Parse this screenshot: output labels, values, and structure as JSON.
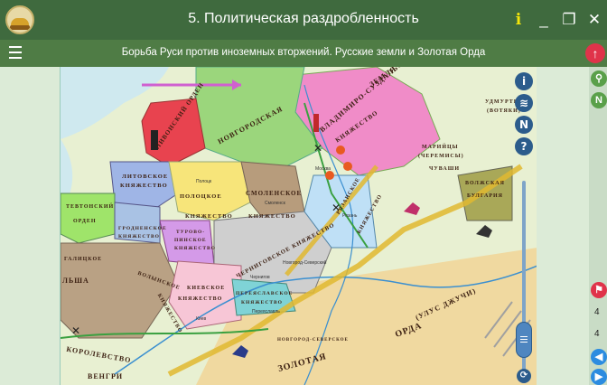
{
  "window": {
    "title": "5. Политическая раздробленность",
    "info_label": "i",
    "minimize_label": "_",
    "maximize_label": "❐",
    "close_label": "✕"
  },
  "subheader": {
    "title": "Борьба Руси против иноземных вторжений. Русские земли и Золотая Орда",
    "up_label": "↑"
  },
  "map_tools": {
    "info_label": "i",
    "layers_label": "≋",
    "north_label": "N",
    "help_label": "?"
  },
  "right_panel": {
    "num1": "4",
    "num2": "4"
  },
  "map": {
    "labels": {
      "vladimir": "ВЛАДИМИРО-СУЗДАЛЬСКАЯ",
      "zemlya": "ЗЕМЛЯ",
      "knyazhestvo_vs": "КНЯЖЕСТВО",
      "novgorod": "НОВГОРОДСКАЯ",
      "livonsky": "ЛИВОНСКИЙ ОРДЕН",
      "litovskoe": "ЛИТОВСКОЕ",
      "knyazhestvo_lit": "КНЯЖЕСТВО",
      "polotskoe": "ПОЛОЦКОЕ",
      "knyazhestvo_pol": "КНЯЖЕСТВО",
      "smolenskoe": "СМОЛЕНСКОЕ",
      "knyazhestvo_sm": "КНЯЖЕСТВО",
      "tevtonsky": "ТЕВТОНСКИЙ",
      "orden": "ОРДЕН",
      "grodnenskoe": "ГРОДНЕНСКОЕ",
      "knyazhestvo_gr": "КНЯЖЕСТВО",
      "turovo": "ТУРОВО-",
      "pinskoe": "ПИНСКОЕ",
      "knyazhestvo_tp": "КНЯЖЕСТВО",
      "chernigovskoe": "ЧЕРНИГОВСКОЕ КНЯЖЕСТВО",
      "ryazanskoe": "РЯЗАНСКОЕ",
      "knyazhestvo_r": "КНЯЖЕСТВО",
      "volynskoe": "ВОЛЫНСКОЕ",
      "knyazhestvo_v": "КНЯЖЕСТВО",
      "galitskoe": "ГАЛИЦКОЕ",
      "kievskoe": "КИЕВСКОЕ",
      "knyazhestvo_k": "КНЯЖЕСТВО",
      "pereyaslavskoe": "ПЕРЕЯСЛАВСКОЕ",
      "knyazhestvo_p": "КНЯЖЕСТВО",
      "novgorod_severskoe": "НОВГОРОД-СЕВЕРСКОЕ",
      "zolotaya": "ЗОЛОТАЯ",
      "orda": "ОРДА",
      "ulus": "(УЛУС ДЖУЧИ)",
      "udmurty": "УДМУРТЫ",
      "votyaki": "(ВОТЯКИ)",
      "mariytsy": "МАРИЙЦЫ",
      "cheremisy": "(ЧЕРЕМИСЫ)",
      "chuvashi": "ЧУВАШИ",
      "volzhskaya": "ВОЛЖСКАЯ",
      "bulgariya": "БУЛГАРИЯ",
      "korolevstvo": "КОРОЛЕВСТВО",
      "polsha": "ЛЬША",
      "vengrii": "ВЕНГРИ",
      "kiev": "Киев",
      "ryazan": "Рязань",
      "moscow": "Москва",
      "smolensk": "Смоленск",
      "polotsk": "Полоцк",
      "chernigov": "Чернигов",
      "pereyaslavl": "Переяславль",
      "novgorod_sev_city": "Новгород-Северский"
    }
  },
  "colors": {
    "titlebar": "#3f6a3e",
    "subbar": "#4f7c45",
    "sea": "#cfe9ef",
    "land": "#e8f0d2",
    "novgorod": "#9bd67c",
    "vladimir": "#f08cc8",
    "livonian": "#e8434f",
    "lithuanian": "#9fb5e6",
    "polotsk": "#f7e57a",
    "smolensk": "#b79c7c",
    "teutonic": "#9fe46a",
    "turovo": "#d49ae8",
    "chernigov": "#cfcfcf",
    "ryazan": "#bfe0f6",
    "volyn": "#b9a184",
    "kiev": "#f7c6d6",
    "pereyaslavl": "#7fd3d6",
    "horde": "#f0d9a0",
    "bulgaria": "#a9a858",
    "route": "#e0b830"
  }
}
